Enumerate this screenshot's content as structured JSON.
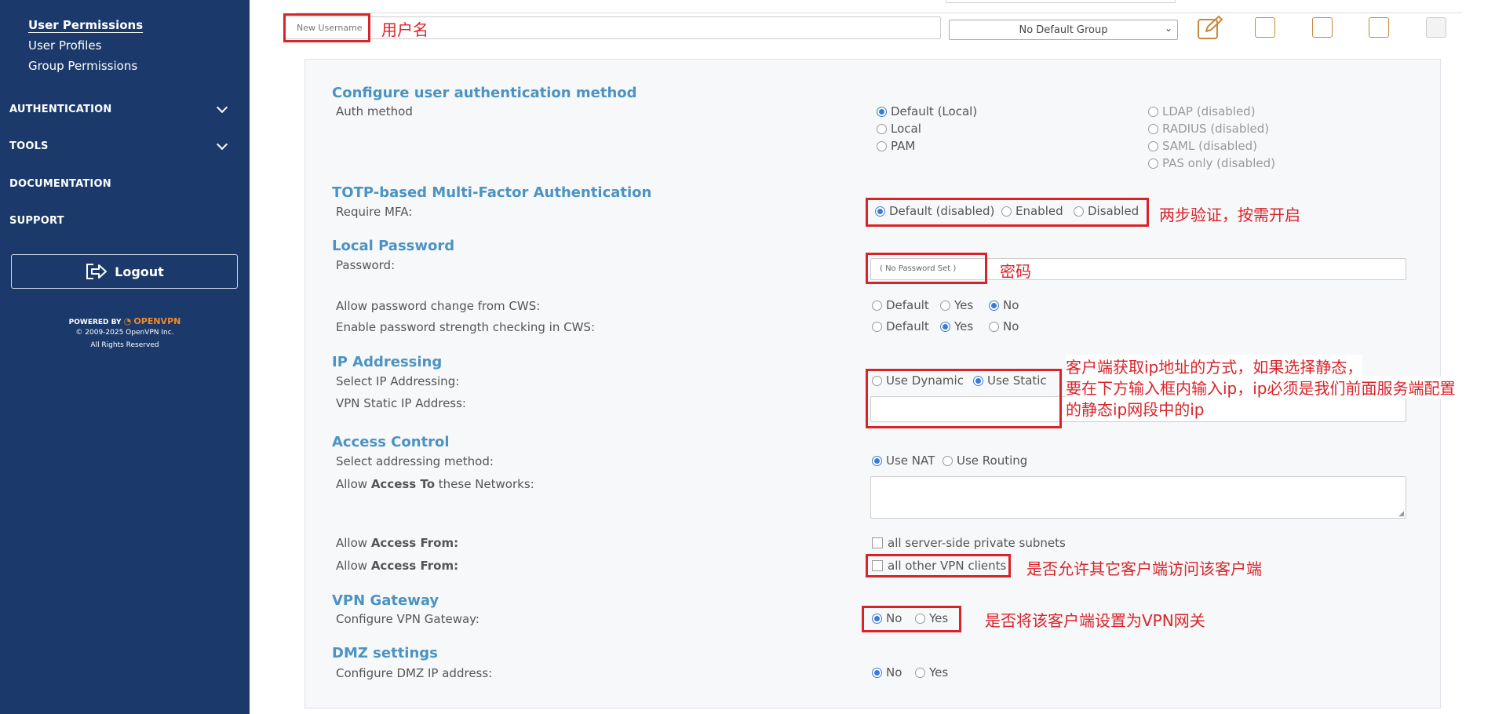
{
  "sidebar": {
    "subitems": [
      "User Permissions",
      "User Profiles",
      "Group Permissions"
    ],
    "nav": [
      "AUTHENTICATION",
      "TOOLS",
      "DOCUMENTATION",
      "SUPPORT"
    ],
    "logout": "Logout",
    "powered_by": "POWERED BY",
    "brand": "OPENVPN",
    "copyright": "© 2009-2025 OpenVPN Inc.",
    "rights": "All Rights Reserved"
  },
  "user_row": {
    "username_placeholder": "New Username",
    "group_select": "No Default Group"
  },
  "sections": {
    "auth": {
      "title": "Configure user authentication method",
      "label": "Auth method",
      "options_left": [
        {
          "label": "Default (Local)",
          "selected": true
        },
        {
          "label": "Local",
          "selected": false
        },
        {
          "label": "PAM",
          "selected": false
        }
      ],
      "options_right": [
        "LDAP (disabled)",
        "RADIUS (disabled)",
        "SAML (disabled)",
        "PAS only (disabled)"
      ]
    },
    "mfa": {
      "title": "TOTP-based Multi-Factor Authentication",
      "label": "Require MFA:",
      "options": [
        "Default (disabled)",
        "Enabled",
        "Disabled"
      ]
    },
    "password": {
      "title": "Local Password",
      "label": "Password:",
      "placeholder": "( No Password Set )",
      "change_label": "Allow password change from CWS:",
      "change_options": [
        "Default",
        "Yes",
        "No"
      ],
      "strength_label": "Enable password strength checking in CWS:",
      "strength_options": [
        "Default",
        "Yes",
        "No"
      ]
    },
    "ip": {
      "title": "IP Addressing",
      "select_label": "Select IP Addressing:",
      "options": [
        "Use Dynamic",
        "Use Static"
      ],
      "static_label": "VPN Static IP Address:"
    },
    "access": {
      "title": "Access Control",
      "method_label": "Select addressing method:",
      "method_options": [
        "Use NAT",
        "Use Routing"
      ],
      "to_label_pre": "Allow ",
      "to_label_bold": "Access To",
      "to_label_post": " these Networks:",
      "from_label_pre": "Allow ",
      "from_label_bold": "Access From:",
      "from1_option": "all server-side private subnets",
      "from2_option": "all other VPN clients"
    },
    "gateway": {
      "title": "VPN Gateway",
      "label": "Configure VPN Gateway:",
      "options": [
        "No",
        "Yes"
      ]
    },
    "dmz": {
      "title": "DMZ settings",
      "label": "Configure DMZ IP address:",
      "options": [
        "No",
        "Yes"
      ]
    }
  },
  "annotations": {
    "username": "用户名",
    "mfa": "两步验证，按需开启",
    "password": "密码",
    "ip_line1": "客户端获取ip地址的方式，如果选择静态，",
    "ip_line2": "要在下方输入框内输入ip，ip必须是我们前面服务端配置",
    "ip_line3": "的静态ip网段中的ip",
    "vpn_clients": "是否允许其它客户端访问该客户端",
    "gateway": "是否将该客户端设置为VPN网关"
  },
  "colors": {
    "sidebar": "#1b3a6b",
    "accent": "#4b93c3",
    "annotation": "#d9232a",
    "radio": "#3a7bd5"
  }
}
